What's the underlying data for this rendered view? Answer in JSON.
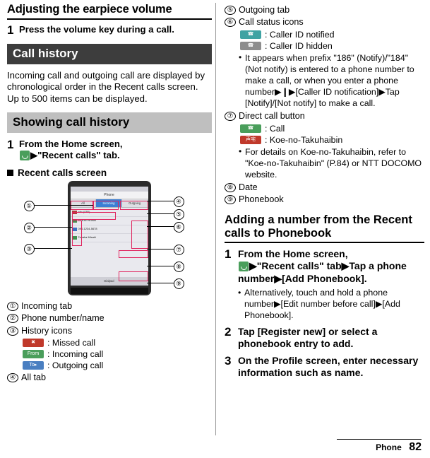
{
  "left": {
    "title": "Adjusting the earpiece volume",
    "step1": {
      "num": "1",
      "text": "Press the volume key during a call."
    },
    "banner_call_history": "Call history",
    "intro_p1": "Incoming call and outgoing call are displayed by chronological order in the Recent calls screen.",
    "intro_p2": "Up to 500 items can be displayed.",
    "banner_showing": "Showing call history",
    "step_show": {
      "num": "1",
      "text_pre": "From the Home screen,",
      "text_post": "▶\"Recent calls\" tab."
    },
    "square_head": "Recent calls screen",
    "phone": {
      "status": "",
      "title": "Phone",
      "tabs": [
        "All",
        "Incoming",
        "Outgoing"
      ],
      "rows": [
        {
          "name": "abc (080)",
          "sub": "12/31 12:34"
        },
        {
          "name": "Suzuki Hiroshi",
          "sub": "12/30 09:12"
        },
        {
          "name": "090-1234-5678",
          "sub": "12/29 18:40"
        },
        {
          "name": "Tanaka Misaki",
          "sub": "12/28 21:05"
        }
      ],
      "bottom": "Dialpad"
    },
    "callouts": [
      "①",
      "②",
      "③",
      "④",
      "⑤",
      "⑥",
      "⑦",
      "⑧",
      "⑨"
    ],
    "legend": [
      {
        "num": "①",
        "text": "Incoming tab"
      },
      {
        "num": "②",
        "text": "Phone number/name"
      },
      {
        "num": "③",
        "text": "History icons"
      },
      {
        "num": "④",
        "text": "All tab"
      }
    ],
    "history_icons": [
      {
        "chip": "✖",
        "chip_class": "red",
        "label": ": Missed call"
      },
      {
        "chip": "From",
        "chip_class": "green",
        "label": ": Incoming call"
      },
      {
        "chip": "To▸",
        "chip_class": "blue",
        "label": ": Outgoing call"
      }
    ]
  },
  "right": {
    "legend_cont": [
      {
        "num": "⑤",
        "text": "Outgoing tab"
      },
      {
        "num": "⑥",
        "text": "Call status icons"
      }
    ],
    "status_icons": [
      {
        "chip": "☎",
        "chip_class": "teal",
        "label": ": Caller ID notified"
      },
      {
        "chip": "☎",
        "chip_class": "gray",
        "label": ": Caller ID hidden"
      }
    ],
    "status_bullet": "It appears when prefix \"186\" (Notify)/\"184\" (Not notify) is entered to a phone number to make a call, or when you enter a phone number▶❙▶[Caller ID notification]▶Tap [Notify]/[Not notify] to make a call.",
    "item7": {
      "num": "⑦",
      "text": "Direct call button"
    },
    "direct_icons": [
      {
        "chip": "☎",
        "chip_class": "green",
        "label": ": Call"
      },
      {
        "chip": "声宅",
        "chip_class": "red",
        "label": ": Koe-no-Takuhaibin"
      }
    ],
    "direct_bullet": "For details on Koe-no-Takuhaibin, refer to \"Koe-no-Takuhaibin\" (P.84) or NTT DOCOMO website.",
    "item8": {
      "num": "⑧",
      "text": "Date"
    },
    "item9": {
      "num": "⑨",
      "text": "Phonebook"
    },
    "heading": "Adding a number from the Recent calls to Phonebook",
    "steps": [
      {
        "num": "1",
        "text_pre": "From the Home screen,",
        "text_post": "▶\"Recent calls\" tab▶Tap a phone number▶[Add Phonebook].",
        "sub": "Alternatively, touch and hold a phone number▶[Edit number before call]▶[Add Phonebook]."
      },
      {
        "num": "2",
        "text": "Tap [Register new] or select a phonebook entry to add."
      },
      {
        "num": "3",
        "text": "On the Profile screen, enter necessary information such as name."
      }
    ]
  },
  "footer": {
    "label": "Phone",
    "page": "82"
  }
}
